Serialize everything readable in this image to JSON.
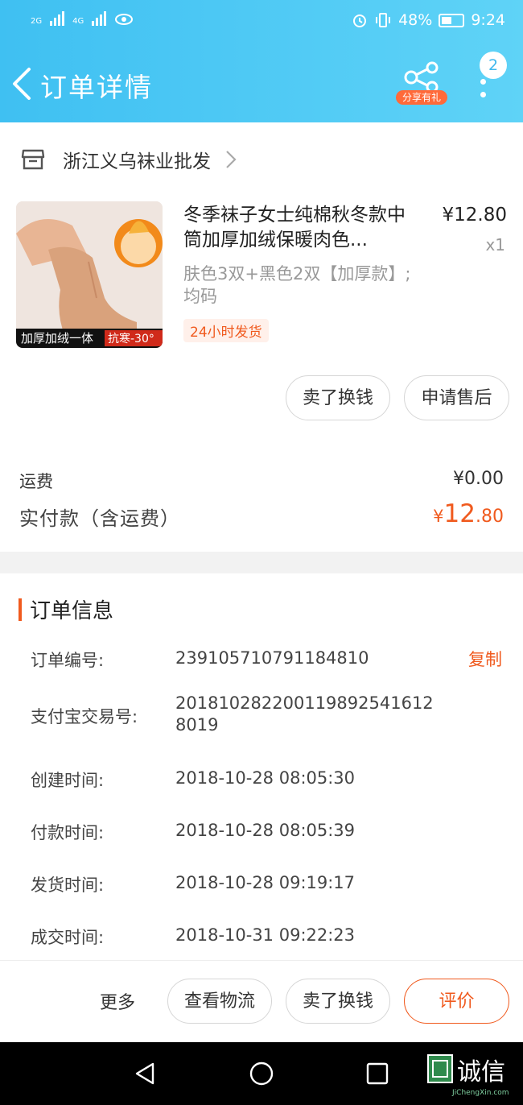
{
  "status_bar": {
    "network1": "2G",
    "network2": "4G",
    "battery_percent": "48%",
    "time": "9:24"
  },
  "header": {
    "title": "订单详情",
    "share_label": "分享有礼",
    "badge_count": "2"
  },
  "store": {
    "name": "浙江义乌袜业批发"
  },
  "product": {
    "name": "冬季袜子女士纯棉秋冬款中筒加厚加绒保暖肉色...",
    "price": "¥12.80",
    "quantity": "x1",
    "sku": "肤色3双+黑色2双【加厚款】;均码",
    "tag": "24小时发货",
    "image_banner_left": "加厚加绒一体",
    "image_banner_right": "抗寒-30°"
  },
  "item_actions": {
    "sell_label": "卖了换钱",
    "after_sale_label": "申请售后"
  },
  "summary": {
    "shipping_label": "运费",
    "shipping_value": "¥0.00",
    "total_label": "实付款（含运费）",
    "total_currency": "¥",
    "total_int": "12",
    "total_dec": ".80"
  },
  "order_info": {
    "title": "订单信息",
    "copy_label": "复制",
    "rows": [
      {
        "label": "订单编号:",
        "value": "239105710791184810"
      },
      {
        "label": "支付宝交易号:",
        "value": "2018102822001198925416128019"
      },
      {
        "label": "创建时间:",
        "value": "2018-10-28 08:05:30"
      },
      {
        "label": "付款时间:",
        "value": "2018-10-28 08:05:39"
      },
      {
        "label": "发货时间:",
        "value": "2018-10-28 09:19:17"
      },
      {
        "label": "成交时间:",
        "value": "2018-10-31 09:22:23"
      }
    ]
  },
  "bottom_actions": {
    "more": "更多",
    "logistics": "查看物流",
    "sell": "卖了换钱",
    "evaluate": "评价"
  },
  "watermark": {
    "text": "诚信",
    "sub": "JiChengXin.com"
  },
  "colors": {
    "header_blue": "#3fc0f2",
    "accent_orange": "#f05a1e"
  }
}
